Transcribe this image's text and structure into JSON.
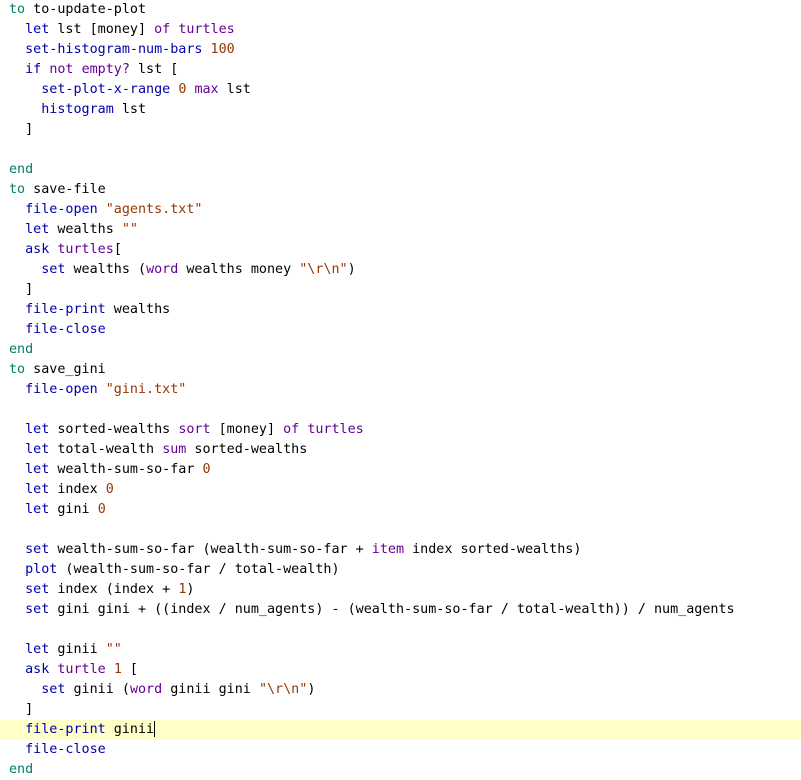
{
  "colors": {
    "background": "#ffffff",
    "current_line": "#ffffc8",
    "keyword": "#007f69",
    "command": "#0000aa",
    "reporter": "#660096",
    "literal": "#963700",
    "plain": "#000000"
  },
  "editor": {
    "current_line_index": 35,
    "lines": [
      [
        {
          "t": "to",
          "c": "kw"
        },
        {
          "t": " to-update-plot",
          "c": "plain"
        }
      ],
      [
        {
          "t": "  let",
          "c": "cmd"
        },
        {
          "t": " lst [money] ",
          "c": "plain"
        },
        {
          "t": "of",
          "c": "rep"
        },
        {
          "t": " ",
          "c": "plain"
        },
        {
          "t": "turtles",
          "c": "rep"
        }
      ],
      [
        {
          "t": "  set-histogram-num-bars",
          "c": "cmd"
        },
        {
          "t": " ",
          "c": "plain"
        },
        {
          "t": "100",
          "c": "num"
        }
      ],
      [
        {
          "t": "  if",
          "c": "cmd"
        },
        {
          "t": " ",
          "c": "plain"
        },
        {
          "t": "not",
          "c": "rep"
        },
        {
          "t": " ",
          "c": "plain"
        },
        {
          "t": "empty?",
          "c": "rep"
        },
        {
          "t": " lst [",
          "c": "plain"
        }
      ],
      [
        {
          "t": "    set-plot-x-range",
          "c": "cmd"
        },
        {
          "t": " ",
          "c": "plain"
        },
        {
          "t": "0",
          "c": "num"
        },
        {
          "t": " ",
          "c": "plain"
        },
        {
          "t": "max",
          "c": "rep"
        },
        {
          "t": " lst",
          "c": "plain"
        }
      ],
      [
        {
          "t": "    histogram",
          "c": "cmd"
        },
        {
          "t": " lst",
          "c": "plain"
        }
      ],
      [
        {
          "t": "  ]",
          "c": "plain"
        }
      ],
      [],
      [
        {
          "t": "end",
          "c": "kw"
        }
      ],
      [
        {
          "t": "to",
          "c": "kw"
        },
        {
          "t": " save-file",
          "c": "plain"
        }
      ],
      [
        {
          "t": "  file-open",
          "c": "cmd"
        },
        {
          "t": " ",
          "c": "plain"
        },
        {
          "t": "\"agents.txt\"",
          "c": "str"
        }
      ],
      [
        {
          "t": "  let",
          "c": "cmd"
        },
        {
          "t": " wealths ",
          "c": "plain"
        },
        {
          "t": "\"\"",
          "c": "str"
        }
      ],
      [
        {
          "t": "  ask",
          "c": "cmd"
        },
        {
          "t": " ",
          "c": "plain"
        },
        {
          "t": "turtles",
          "c": "rep"
        },
        {
          "t": "[",
          "c": "plain"
        }
      ],
      [
        {
          "t": "    set",
          "c": "cmd"
        },
        {
          "t": " wealths (",
          "c": "plain"
        },
        {
          "t": "word",
          "c": "rep"
        },
        {
          "t": " wealths money ",
          "c": "plain"
        },
        {
          "t": "\"\\r\\n\"",
          "c": "str"
        },
        {
          "t": ")",
          "c": "plain"
        }
      ],
      [
        {
          "t": "  ]",
          "c": "plain"
        }
      ],
      [
        {
          "t": "  file-print",
          "c": "cmd"
        },
        {
          "t": " wealths",
          "c": "plain"
        }
      ],
      [
        {
          "t": "  file-close",
          "c": "cmd"
        }
      ],
      [
        {
          "t": "end",
          "c": "kw"
        }
      ],
      [
        {
          "t": "to",
          "c": "kw"
        },
        {
          "t": " save_gini",
          "c": "plain"
        }
      ],
      [
        {
          "t": "  file-open",
          "c": "cmd"
        },
        {
          "t": " ",
          "c": "plain"
        },
        {
          "t": "\"gini.txt\"",
          "c": "str"
        }
      ],
      [],
      [
        {
          "t": "  let",
          "c": "cmd"
        },
        {
          "t": " sorted-wealths ",
          "c": "plain"
        },
        {
          "t": "sort",
          "c": "rep"
        },
        {
          "t": " [money] ",
          "c": "plain"
        },
        {
          "t": "of",
          "c": "rep"
        },
        {
          "t": " ",
          "c": "plain"
        },
        {
          "t": "turtles",
          "c": "rep"
        }
      ],
      [
        {
          "t": "  let",
          "c": "cmd"
        },
        {
          "t": " total-wealth ",
          "c": "plain"
        },
        {
          "t": "sum",
          "c": "rep"
        },
        {
          "t": " sorted-wealths",
          "c": "plain"
        }
      ],
      [
        {
          "t": "  let",
          "c": "cmd"
        },
        {
          "t": " wealth-sum-so-far ",
          "c": "plain"
        },
        {
          "t": "0",
          "c": "num"
        }
      ],
      [
        {
          "t": "  let",
          "c": "cmd"
        },
        {
          "t": " index ",
          "c": "plain"
        },
        {
          "t": "0",
          "c": "num"
        }
      ],
      [
        {
          "t": "  let",
          "c": "cmd"
        },
        {
          "t": " gini ",
          "c": "plain"
        },
        {
          "t": "0",
          "c": "num"
        }
      ],
      [],
      [
        {
          "t": "  set",
          "c": "cmd"
        },
        {
          "t": " wealth-sum-so-far (wealth-sum-so-far + ",
          "c": "plain"
        },
        {
          "t": "item",
          "c": "rep"
        },
        {
          "t": " index sorted-wealths)",
          "c": "plain"
        }
      ],
      [
        {
          "t": "  plot",
          "c": "cmd"
        },
        {
          "t": " (wealth-sum-so-far / total-wealth)",
          "c": "plain"
        }
      ],
      [
        {
          "t": "  set",
          "c": "cmd"
        },
        {
          "t": " index (index + ",
          "c": "plain"
        },
        {
          "t": "1",
          "c": "num"
        },
        {
          "t": ")",
          "c": "plain"
        }
      ],
      [
        {
          "t": "  set",
          "c": "cmd"
        },
        {
          "t": " gini gini + ((index / num_agents) - (wealth-sum-so-far / total-wealth)) / num_agents",
          "c": "plain"
        }
      ],
      [],
      [
        {
          "t": "  let",
          "c": "cmd"
        },
        {
          "t": " ginii ",
          "c": "plain"
        },
        {
          "t": "\"\"",
          "c": "str"
        }
      ],
      [
        {
          "t": "  ask",
          "c": "cmd"
        },
        {
          "t": " ",
          "c": "plain"
        },
        {
          "t": "turtle",
          "c": "rep"
        },
        {
          "t": " ",
          "c": "plain"
        },
        {
          "t": "1",
          "c": "num"
        },
        {
          "t": " [",
          "c": "plain"
        }
      ],
      [
        {
          "t": "    set",
          "c": "cmd"
        },
        {
          "t": " ginii (",
          "c": "plain"
        },
        {
          "t": "word",
          "c": "rep"
        },
        {
          "t": " ginii gini ",
          "c": "plain"
        },
        {
          "t": "\"\\r\\n\"",
          "c": "str"
        },
        {
          "t": ")",
          "c": "plain"
        }
      ],
      [
        {
          "t": "  ]",
          "c": "plain"
        }
      ],
      [
        {
          "t": "  file-print",
          "c": "cmd"
        },
        {
          "t": " ginii",
          "c": "plain"
        }
      ],
      [
        {
          "t": "  file-close",
          "c": "cmd"
        }
      ],
      [
        {
          "t": "end",
          "c": "kw"
        }
      ]
    ]
  }
}
